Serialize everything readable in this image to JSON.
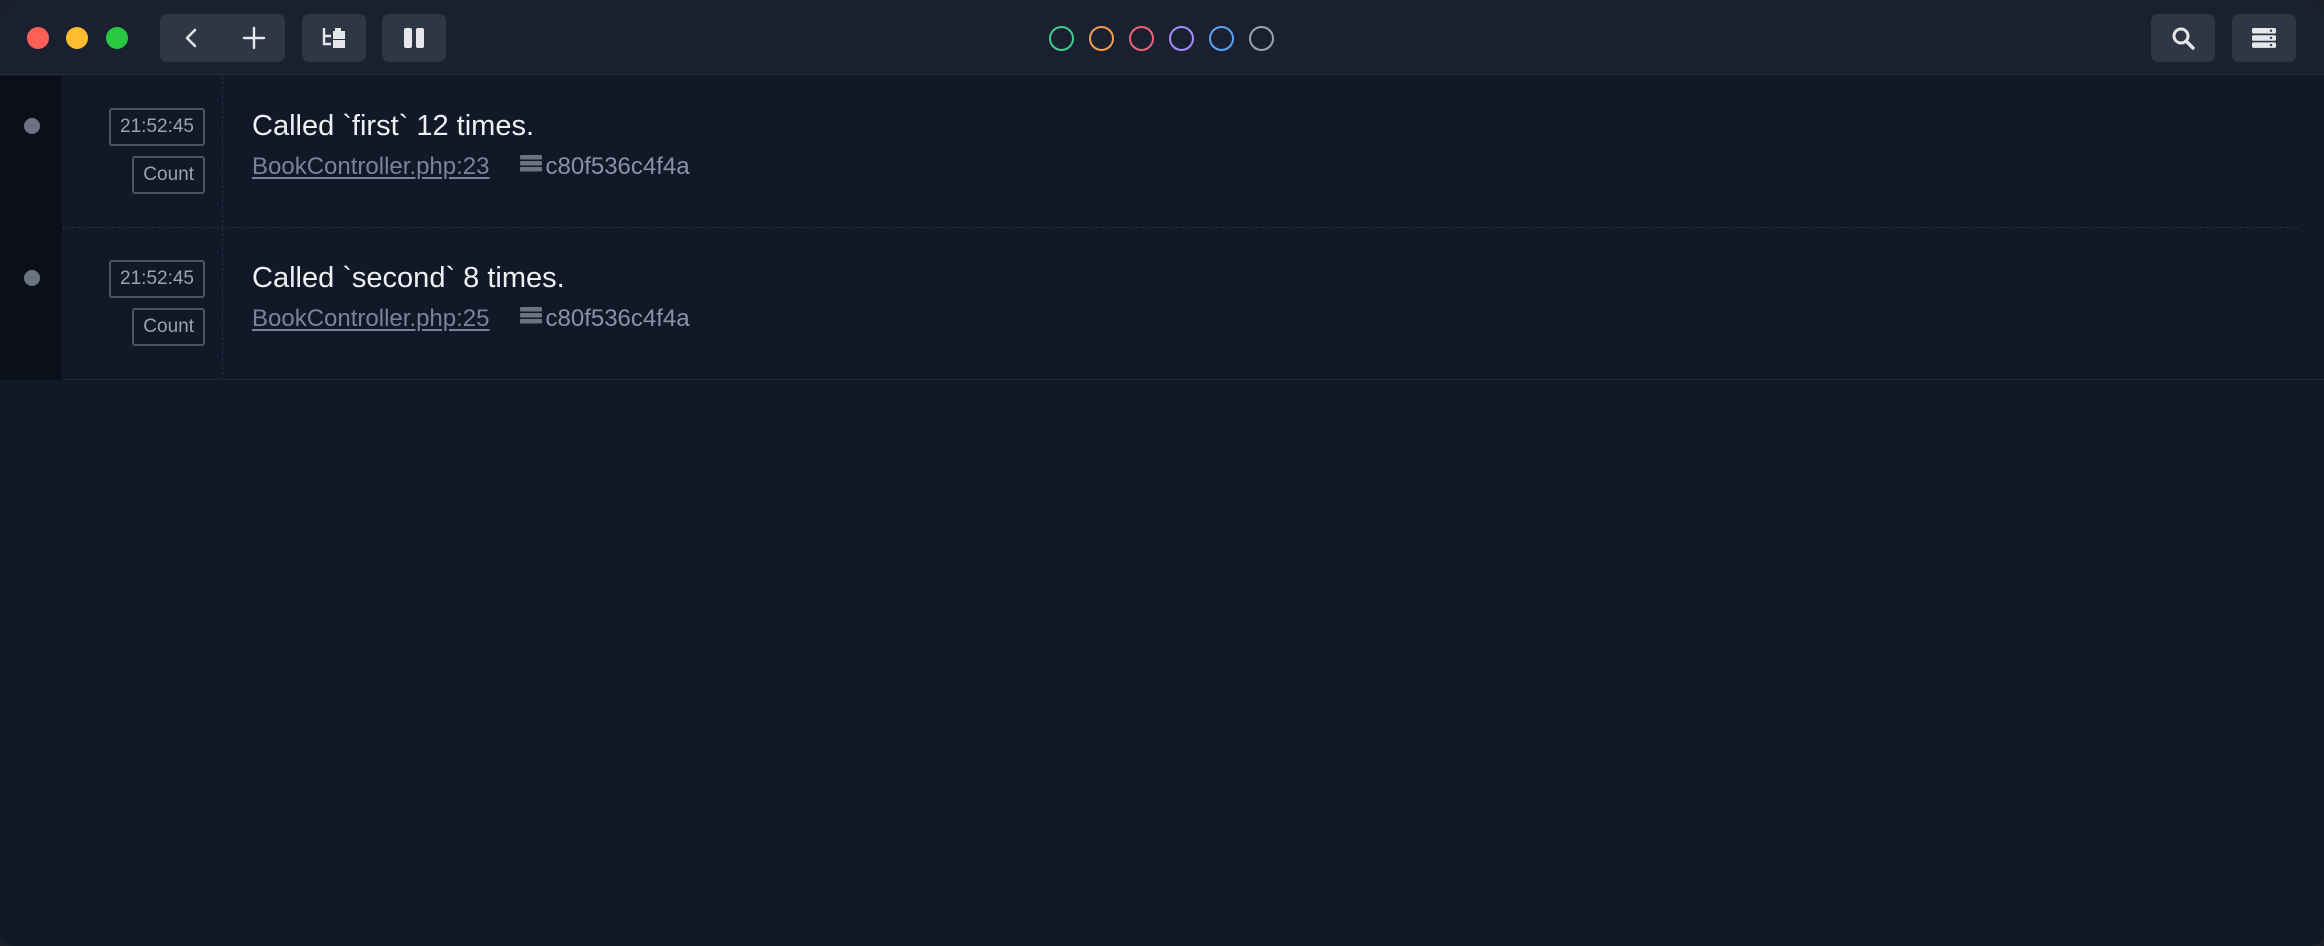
{
  "toolbar": {
    "left_icons": [
      "chevron-left-icon",
      "plus-icon",
      "tree-view-icon",
      "pause-icon"
    ],
    "right_icons": [
      "search-icon",
      "server-list-icon"
    ]
  },
  "filters": [
    {
      "name": "green",
      "color": "#3ecf8e"
    },
    {
      "name": "orange",
      "color": "#f59e4b"
    },
    {
      "name": "red",
      "color": "#f0607a"
    },
    {
      "name": "purple",
      "color": "#a78bfa"
    },
    {
      "name": "blue",
      "color": "#5aa2f8"
    },
    {
      "name": "gray",
      "color": "#9ca3af"
    }
  ],
  "entries": [
    {
      "time": "21:52:45",
      "type": "Count",
      "message": "Called `first` 12 times.",
      "file": "BookController.php:23",
      "host": "c80f536c4f4a"
    },
    {
      "time": "21:52:45",
      "type": "Count",
      "message": "Called `second` 8 times.",
      "file": "BookController.php:25",
      "host": "c80f536c4f4a"
    }
  ],
  "colors": {
    "background": "#111827",
    "titlebar": "#1a2030",
    "button": "#2f3645"
  }
}
